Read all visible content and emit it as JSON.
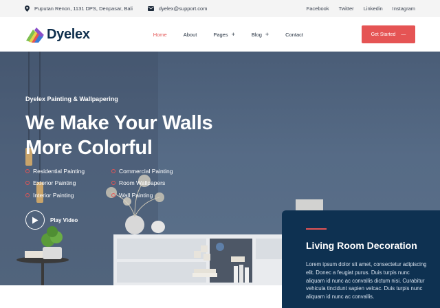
{
  "topbar": {
    "address": "Puputan Renon, 1131 DPS, Denpasar, Bali",
    "email": "dyelex@support.com",
    "socials": [
      "Facebook",
      "Twitter",
      "Linkedin",
      "Instagram"
    ]
  },
  "header": {
    "brand": "Dyelex",
    "nav": [
      {
        "label": "Home",
        "active": true,
        "has_plus": false
      },
      {
        "label": "About",
        "active": false,
        "has_plus": false
      },
      {
        "label": "Pages",
        "active": false,
        "has_plus": true
      },
      {
        "label": "Blog",
        "active": false,
        "has_plus": true
      },
      {
        "label": "Contact",
        "active": false,
        "has_plus": false
      }
    ],
    "cta_label": "Get Started",
    "cta_arrow": "—"
  },
  "hero": {
    "subtitle": "Dyelex Painting & Wallpapering",
    "headline_line1": "We Make Your Walls",
    "headline_line2": "More Colorful",
    "services_left": [
      "Residential Painting",
      "Exterior Painting",
      "Interior Painting"
    ],
    "services_right": [
      "Commercial Painting",
      "Room Wallpapers",
      "Wall Painting"
    ],
    "play_label": "Play Video"
  },
  "card": {
    "title": "Living Room Decoration",
    "text": "Lorem ipsum dolor sit amet, consectetur adipiscing elit. Donec a feugiat purus. Duis turpis nunc aliquam id nunc ac convallis dictum nisi. Curabitur vehicula tincidunt sapien velcac. Duis turpis nunc aliquam id nunc ac convallis."
  },
  "colors": {
    "accent": "#e55454",
    "navy": "#0e3151",
    "hero_wall": "#566b86",
    "topbar_bg": "#f4f4f4"
  }
}
